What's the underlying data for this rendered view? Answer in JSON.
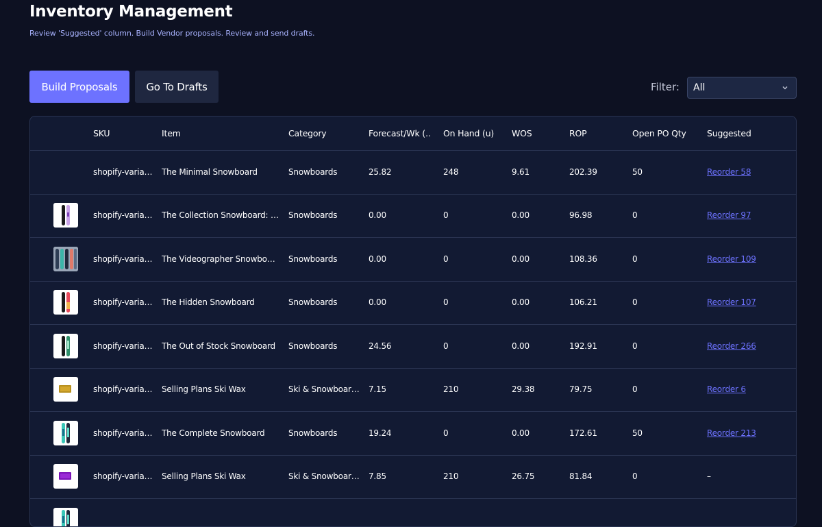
{
  "header": {
    "title": "Inventory Management",
    "subtitle": "Review 'Suggested' column.  Build Vendor proposals.  Review and send drafts."
  },
  "toolbar": {
    "build_label": "Build Proposals",
    "drafts_label": "Go To Drafts",
    "filter_label": "Filter:",
    "filter_value": "All"
  },
  "colors": {
    "accent": "#6d72ff",
    "background": "#0d1122",
    "table_bg": "#121a33",
    "subtitle": "#a9b3ff"
  },
  "table": {
    "columns": [
      "SKU",
      "Item",
      "Category",
      "Forecast/Wk (…",
      "On Hand (u)",
      "WOS",
      "ROP",
      "Open PO Qty",
      "Suggested"
    ],
    "rows": [
      {
        "thumb": "none",
        "sku": "shopify-varia…",
        "item": "The Minimal Snowboard",
        "category": "Snowboards",
        "forecast": "25.82",
        "on_hand": "248",
        "wos": "9.61",
        "rop": "202.39",
        "open_po": "50",
        "suggested": "Reorder 58"
      },
      {
        "thumb": "snowboard-purple-icon",
        "sku": "shopify-varia…",
        "item": "The Collection Snowboard: …",
        "category": "Snowboards",
        "forecast": "0.00",
        "on_hand": "0",
        "wos": "0.00",
        "rop": "96.98",
        "open_po": "0",
        "suggested": "Reorder 97"
      },
      {
        "thumb": "snowboards-group-icon",
        "sku": "shopify-varia…",
        "item": "The Videographer Snowboa…",
        "category": "Snowboards",
        "forecast": "0.00",
        "on_hand": "0",
        "wos": "0.00",
        "rop": "108.36",
        "open_po": "0",
        "suggested": "Reorder 109"
      },
      {
        "thumb": "snowboard-red-icon",
        "sku": "shopify-varia…",
        "item": "The Hidden Snowboard",
        "category": "Snowboards",
        "forecast": "0.00",
        "on_hand": "0",
        "wos": "0.00",
        "rop": "106.21",
        "open_po": "0",
        "suggested": "Reorder 107"
      },
      {
        "thumb": "snowboard-green-icon",
        "sku": "shopify-varia…",
        "item": "The Out of Stock Snowboard",
        "category": "Snowboards",
        "forecast": "24.56",
        "on_hand": "0",
        "wos": "0.00",
        "rop": "192.91",
        "open_po": "0",
        "suggested": "Reorder 266"
      },
      {
        "thumb": "ski-wax-gold-icon",
        "sku": "shopify-varia…",
        "item": "Selling Plans Ski Wax",
        "category": "Ski & Snowboar…",
        "forecast": "7.15",
        "on_hand": "210",
        "wos": "29.38",
        "rop": "79.75",
        "open_po": "0",
        "suggested": "Reorder 6"
      },
      {
        "thumb": "snowboard-teal-icon",
        "sku": "shopify-varia…",
        "item": "The Complete Snowboard",
        "category": "Snowboards",
        "forecast": "19.24",
        "on_hand": "0",
        "wos": "0.00",
        "rop": "172.61",
        "open_po": "50",
        "suggested": "Reorder 213"
      },
      {
        "thumb": "ski-wax-purple-icon",
        "sku": "shopify-varia…",
        "item": "Selling Plans Ski Wax",
        "category": "Ski & Snowboar…",
        "forecast": "7.85",
        "on_hand": "210",
        "wos": "26.75",
        "rop": "81.84",
        "open_po": "0",
        "suggested": "–"
      },
      {
        "thumb": "snowboard-teal-icon",
        "sku": "",
        "item": "",
        "category": "",
        "forecast": "",
        "on_hand": "",
        "wos": "",
        "rop": "",
        "open_po": "",
        "suggested": ""
      }
    ]
  }
}
